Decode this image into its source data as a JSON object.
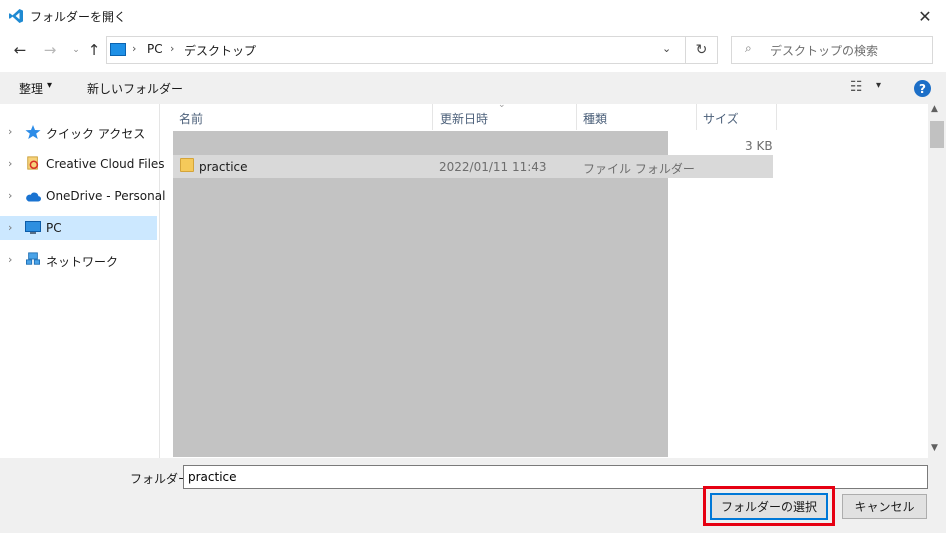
{
  "window": {
    "title": "フォルダーを開く",
    "close_glyph": "✕"
  },
  "nav": {
    "back_glyph": "←",
    "forward_glyph": "→",
    "recent_glyph": "⌄",
    "up_glyph": "↑",
    "refresh_glyph": "↻",
    "dropdown_glyph": "⌄",
    "separator_glyph": "›"
  },
  "address": {
    "crumbs": [
      "PC",
      "デスクトップ"
    ]
  },
  "search": {
    "placeholder": "デスクトップの検索",
    "icon_glyph": "⌕"
  },
  "toolbar": {
    "organize_label": "整理",
    "caret_glyph": "▾",
    "new_folder_label": "新しいフォルダー",
    "view_glyph": "☷",
    "help_glyph": "?"
  },
  "sidebar": {
    "chevron_glyph": "›",
    "items": [
      {
        "label": "クイック アクセス",
        "icon": "star-icon"
      },
      {
        "label": "Creative Cloud Files",
        "icon": "creative-cloud-icon"
      },
      {
        "label": "OneDrive - Personal",
        "icon": "cloud-icon"
      },
      {
        "label": "PC",
        "icon": "pc-icon",
        "selected": true
      },
      {
        "label": "ネットワーク",
        "icon": "network-icon"
      }
    ]
  },
  "columns": {
    "name": "名前",
    "date": "更新日時",
    "type": "種類",
    "size": "サイズ",
    "sort_glyph": "⌄"
  },
  "files": [
    {
      "name": "practice",
      "date": "2022/01/11 11:43",
      "type": "ファイル フォルダー",
      "size": ""
    }
  ],
  "stray_size_text": "3 KB",
  "scroll": {
    "up_glyph": "▲",
    "down_glyph": "▼"
  },
  "footer": {
    "folder_label": "フォルダー:",
    "folder_value": "practice",
    "select_label": "フォルダーの選択",
    "cancel_label": "キャンセル"
  },
  "colors": {
    "accent": "#0078d7",
    "highlight_box": "#e60012",
    "selection": "#cce8ff"
  }
}
